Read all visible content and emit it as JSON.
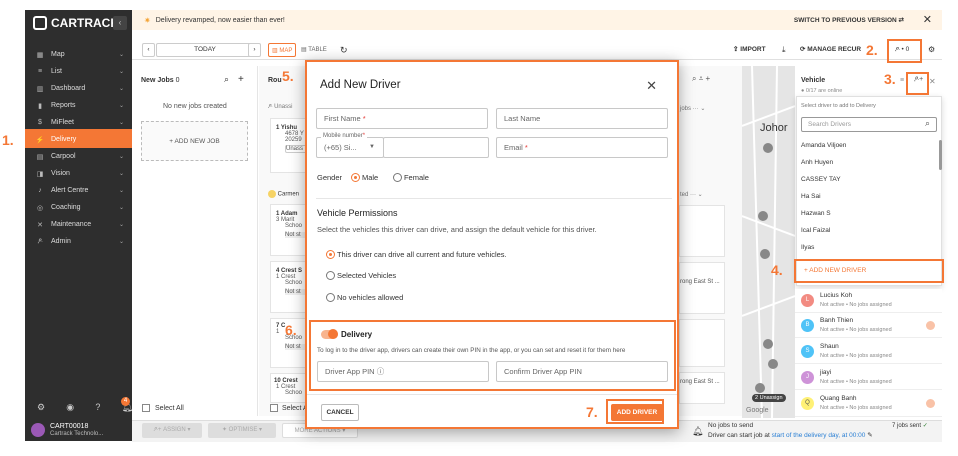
{
  "app": {
    "brand": "CARTRACK"
  },
  "colors": {
    "accent": "#f47735",
    "sidebar_bg": "#2e2e2e",
    "banner_bg": "#fff4e6"
  },
  "banner": {
    "text": "Delivery revamped, now easier than ever!",
    "switch_label": "SWITCH TO PREVIOUS VERSION"
  },
  "sidebar": {
    "items": [
      {
        "label": "Map",
        "icon": "map-icon"
      },
      {
        "label": "List",
        "icon": "list-icon"
      },
      {
        "label": "Dashboard",
        "icon": "dashboard-icon"
      },
      {
        "label": "Reports",
        "icon": "reports-icon"
      },
      {
        "label": "MiFleet",
        "icon": "dollar-icon"
      },
      {
        "label": "Delivery",
        "icon": "delivery-icon"
      },
      {
        "label": "Carpool",
        "icon": "calendar-icon"
      },
      {
        "label": "Vision",
        "icon": "camera-icon"
      },
      {
        "label": "Alert Centre",
        "icon": "bell-icon"
      },
      {
        "label": "Coaching",
        "icon": "steering-icon"
      },
      {
        "label": "Maintenance",
        "icon": "wrench-icon"
      },
      {
        "label": "Admin",
        "icon": "users-icon"
      }
    ],
    "notification_count": "4",
    "user": {
      "name": "CART00018",
      "company": "Cartrack Technolo..."
    }
  },
  "toolbar": {
    "today": "TODAY",
    "map_tab": "MAP",
    "table_tab": "TABLE",
    "import": "IMPORT",
    "manage_recurring": "MANAGE RECUR",
    "driver_count": "0"
  },
  "jobs_column": {
    "title": "New Jobs",
    "count": "0",
    "empty_text": "No new jobs created",
    "add_job": "+ ADD NEW JOB",
    "select_all": "Select All"
  },
  "routes": {
    "title": "Rou",
    "unassigned": "Unassi",
    "carmen": "Carmen",
    "cards": [
      {
        "num": "1",
        "name": "Yishu",
        "line2": "4678 Y",
        "line3": "20259",
        "tag": "Unass"
      },
      {
        "num": "1",
        "name": "Adam",
        "line2": "3 Marit",
        "line3": "Schoo",
        "tag": "Not st"
      },
      {
        "num": "4",
        "name": "Crest S",
        "line2": "1 Crest",
        "line3": "Schoo",
        "tag": "Not st"
      },
      {
        "num": "7",
        "name": "C",
        "line2": "1",
        "line3": "Schoo",
        "tag": "Not st"
      },
      {
        "num": "10",
        "name": "Crest",
        "line2": "1 Crest",
        "line3": "Schoo",
        "tag": "Not st"
      }
    ],
    "right_snips": [
      "jobs",
      "ted",
      "rong East St ...",
      "rong East St ..."
    ],
    "select_all": "Select A"
  },
  "bottom_bar": {
    "assign": "ASSIGN",
    "optimise": "OPTIMISE",
    "more_actions": "MORE ACTIONS",
    "nojobs": "No jobs to send",
    "start_note": "Driver can start job at",
    "start_link": "start of the delivery day, at 00:00",
    "sent": "7 jobs sent"
  },
  "modal": {
    "title": "Add New Driver",
    "first_name": "First Name",
    "last_name": "Last Name",
    "mobile_label": "Mobile number",
    "country_code": "(+65) Si...",
    "email": "Email",
    "gender_label": "Gender",
    "male": "Male",
    "female": "Female",
    "vp_title": "Vehicle Permissions",
    "vp_desc": "Select the vehicles this driver can drive, and assign the default vehicle for this driver.",
    "vp_options": [
      "This driver can drive all current and future vehicles.",
      "Selected Vehicles",
      "No vehicles allowed"
    ],
    "delivery_label": "Delivery",
    "delivery_desc": "To log in to the driver app, drivers can create their own PIN in the app, or you can set and reset it for them here",
    "pin": "Driver App PIN",
    "confirm_pin": "Confirm Driver App PIN",
    "cancel": "CANCEL",
    "add": "ADD DRIVER"
  },
  "right_panel": {
    "vehicle_title": "Vehicle",
    "online": "0/17 are online",
    "select_hint": "Select driver to add to Delivery",
    "search_placeholder": "Search Drivers",
    "drivers": [
      "Amanda Viljoen",
      "Anh Huyen",
      "CASSEY TAY",
      "Ha Sai",
      "Hazwan S",
      "Ical Faizal",
      "Ilyas"
    ],
    "add_new_driver": "+ ADD NEW DRIVER",
    "driver_list": [
      {
        "initial": "L",
        "name": "Lucius Koh",
        "status": "Not active • No jobs assigned",
        "color": "#f28b82"
      },
      {
        "initial": "B",
        "name": "Banh Thien",
        "status": "Not active • No jobs assigned",
        "color": "#4fc3f7"
      },
      {
        "initial": "S",
        "name": "Shaun",
        "status": "Not active • No jobs assigned",
        "color": "#4fc3f7"
      },
      {
        "initial": "J",
        "name": "jiayi",
        "status": "Not active • No jobs assigned",
        "color": "#ce93d8"
      },
      {
        "initial": "Q",
        "name": "Quang Banh",
        "status": "Not active • No jobs assigned",
        "color": "#fff176"
      }
    ],
    "map_label": "Johor",
    "unassigned_chip": "Unassign",
    "unassigned_count": "2",
    "google": "Google"
  },
  "callouts": [
    "1.",
    "2.",
    "3.",
    "4.",
    "5.",
    "6.",
    "7."
  ]
}
